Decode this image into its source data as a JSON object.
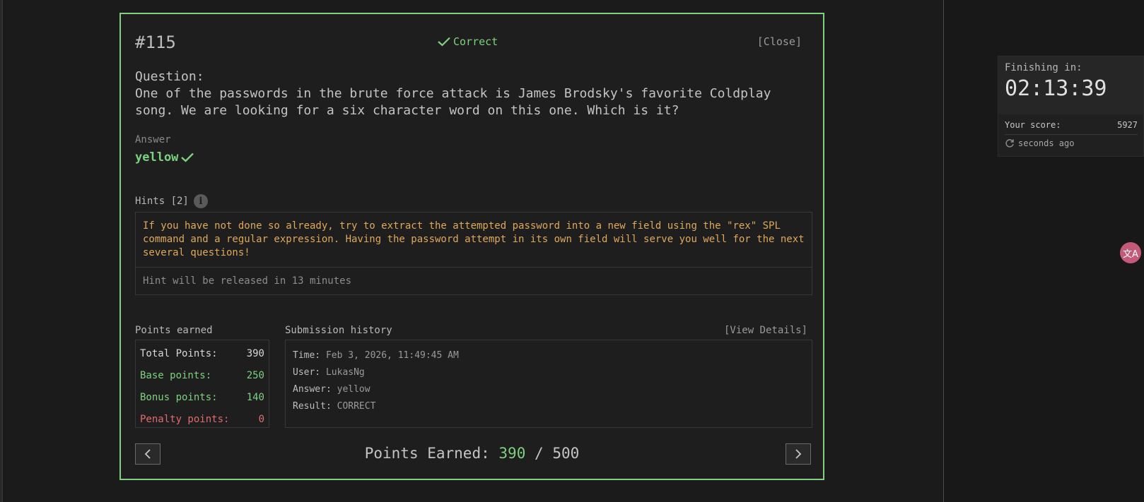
{
  "question": {
    "number": "#115",
    "status_label": "Correct",
    "close_label": "[Close]",
    "label": "Question:",
    "text": "One of the passwords in the brute force attack is James Brodsky's favorite Coldplay song. We are looking for a six character word on this one. Which is it?"
  },
  "answer": {
    "label": "Answer",
    "value": "yellow"
  },
  "hints": {
    "label": "Hints [2]",
    "items": [
      "If you have not done so already, try to extract the attempted password into a new field using the \"rex\" SPL command and a regular expression. Having the password attempt in its own field will serve you well for the next several questions!",
      "Hint will be released in 13 minutes"
    ]
  },
  "points": {
    "label": "Points earned",
    "total_label": "Total Points:",
    "total_value": "390",
    "base_label": "Base points:",
    "base_value": "250",
    "bonus_label": "Bonus points:",
    "bonus_value": "140",
    "penalty_label": "Penalty points:",
    "penalty_value": "0"
  },
  "submission": {
    "label": "Submission history",
    "view_details_label": "[View Details]",
    "time_key": "Time:",
    "time_value": "Feb 3, 2026, 11:49:45 AM",
    "user_key": "User:",
    "user_value": "LukasNg",
    "answer_key": "Answer:",
    "answer_value": "yellow",
    "result_key": "Result:",
    "result_value": "CORRECT"
  },
  "footer": {
    "earned_label": "Points Earned:",
    "earned_value": "390",
    "earned_sep": "/",
    "earned_max": "500"
  },
  "timer": {
    "finishing_label": "Finishing in:",
    "time": "02:13:39",
    "score_label": "Your score:",
    "score_value": "5927",
    "updated": "seconds ago"
  },
  "colors": {
    "accent_green": "#7ed17e",
    "hint_orange": "#e0a85a",
    "penalty_red": "#e06c6c"
  }
}
